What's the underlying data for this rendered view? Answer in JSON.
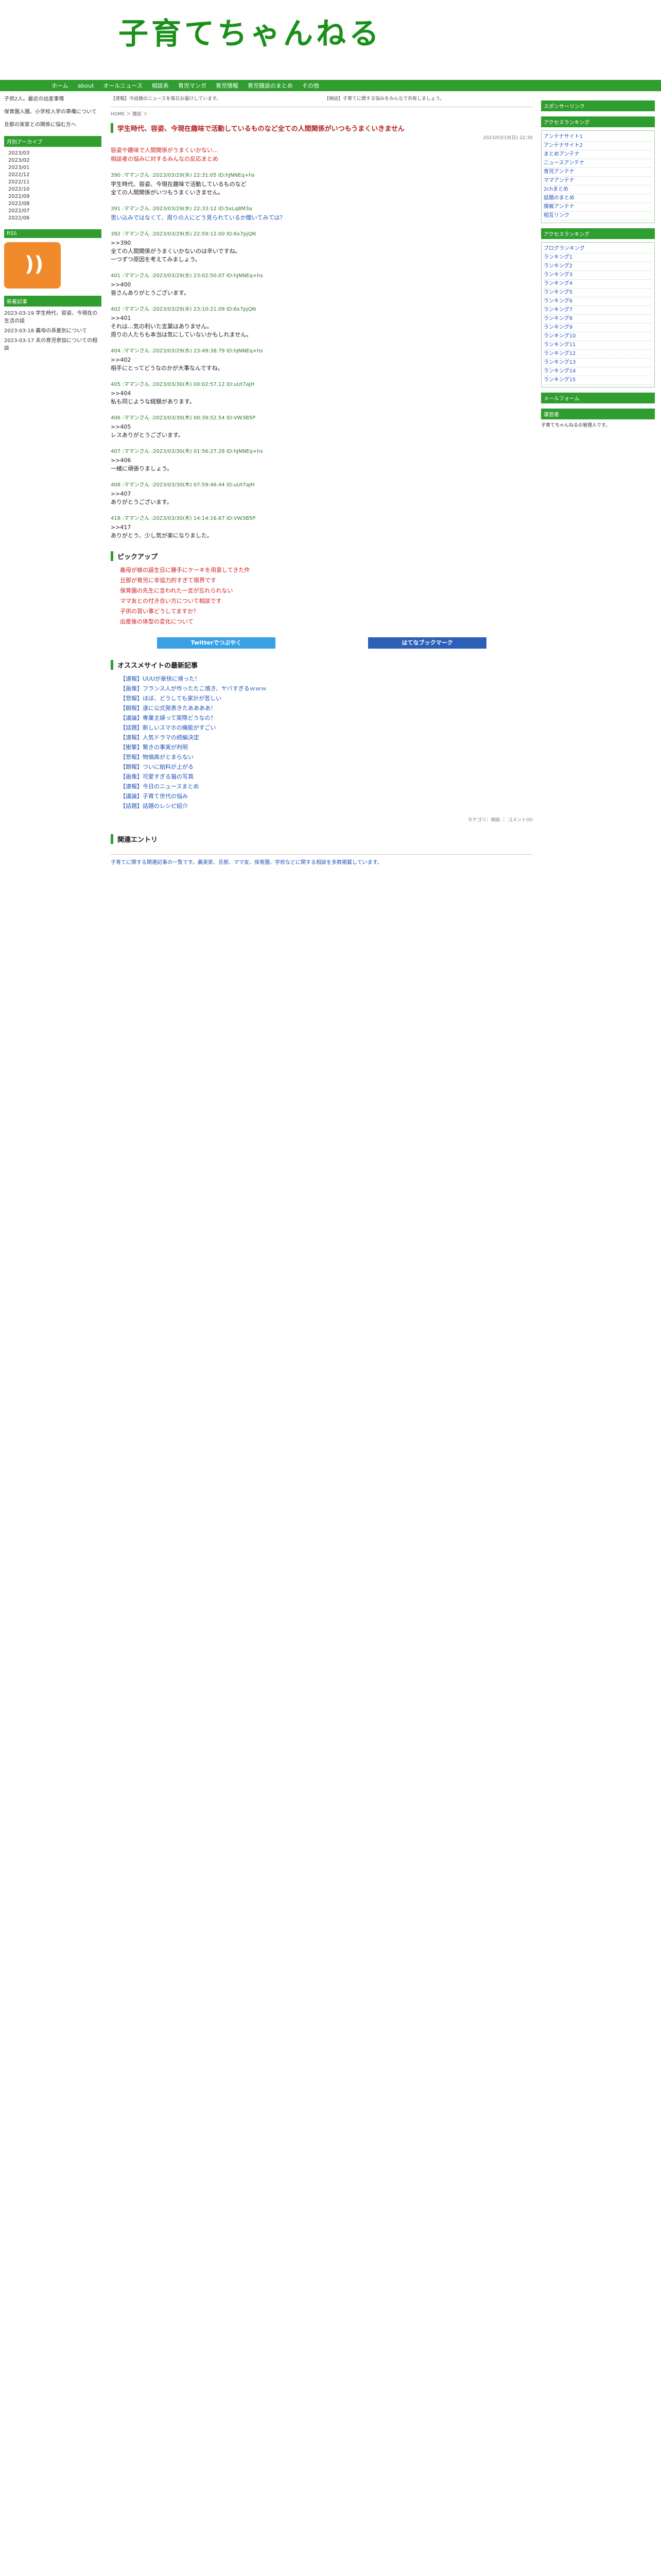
{
  "site": {
    "logo": "子育てちゃんねる"
  },
  "nav": [
    "ホーム",
    "about",
    "オールニュース",
    "相談系",
    "育児マンガ",
    "育児情報",
    "育児雑談のまとめ",
    "その他"
  ],
  "left": {
    "intro": [
      "子供2人。最近の出産事情",
      "保育園入園、小学校入学の準備について",
      "旦那の実家との関係に悩む方へ"
    ],
    "archive_head": "月別アーカイブ",
    "archive": [
      "2023/03",
      "2023/02",
      "2023/01",
      "2022/12",
      "2022/11",
      "2022/10",
      "2022/09",
      "2022/08",
      "2022/07",
      "2022/06"
    ],
    "rss_head": "RSS",
    "recent_head": "新着記事",
    "recent": [
      "2023-03-19 学生時代、容姿、今現在の生活の話",
      "2023-03-18 義母の孫差別について",
      "2023-03-17 夫の育児参加についての相談"
    ]
  },
  "main": {
    "topbox_left": "【速報】今話題のニュースを毎日お届けしています。",
    "topbox_right": "【相談】子育てに関する悩みをみんなで共有しましょう。",
    "breadcrumb": "HOME ＞ 雑談 ＞",
    "title": "学生時代、容姿、今現在趣味で活動しているものなど全ての人間関係がいつもうまくいきません",
    "date": "2023/03/19(日) 22:30",
    "redlinks": [
      "容姿や趣味で人間関係がうまくいかない…",
      "相談者の悩みに対するみんなの反応まとめ"
    ],
    "posts": [
      {
        "head": "390 :ママンさん :2023/03/29(水) 22:31:05 ID:hJNNEq+hs",
        "body": "学生時代、容姿、今現在趣味で活動しているものなど\n全ての人間関係がいつもうまくいきません。",
        "blue": false
      },
      {
        "head": "391 :ママンさん :2023/03/29(水) 22:33:12 ID:5xLq8M3a",
        "body": "思い込みではなくて、周りの人にどう見られているか聞いてみては？",
        "blue": true
      },
      {
        "head": "392 :ママンさん :2023/03/29(水) 22:59:12.00 ID:6x7pjQN",
        "body": ">>390\n全ての人間関係がうまくいかないのは辛いですね。\n一つずつ原因を考えてみましょう。",
        "blue": false
      },
      {
        "head": "401 :ママンさん :2023/03/29(水) 23:02:50.07 ID:hJNNEq+hs",
        "body": ">>400\n皆さんありがとうございます。",
        "blue": false
      },
      {
        "head": "402 :ママンさん :2023/03/29(水) 23:10:21.09 ID:6x7pjQN",
        "body": ">>401\nそれは…気の利いた言葉はありません。\n周りの人たちも本当は気にしていないかもしれません。",
        "blue": false
      },
      {
        "head": "404 :ママンさん :2023/03/29(水) 23:49:38.79 ID:hJNNEq+hs",
        "body": ">>402\n相手にとってどうなのかが大事なんですね。",
        "blue": false
      },
      {
        "head": "405 :ママンさん :2023/03/30(木) 00:02:57.12 ID:uUt7aJH",
        "body": ">>404\n私も同じような経験があります。",
        "blue": false
      },
      {
        "head": "406 :ママンさん :2023/03/30(木) 00:39:52.54 ID:VW3B5P",
        "body": ">>405\nレスありがとうございます。",
        "blue": false
      },
      {
        "head": "407 :ママンさん :2023/03/30(木) 01:56:27.28 ID:hJNNEq+hs",
        "body": ">>406\n一緒に頑張りましょう。",
        "blue": false
      },
      {
        "head": "408 :ママンさん :2023/03/30(木) 07:59:46.44 ID:uUt7aJH",
        "body": ">>407\nありがとうございます。",
        "blue": false
      },
      {
        "head": "418 :ママンさん :2023/03/30(木) 14:14:16.67 ID:VW3B5P",
        "body": ">>417\nありがとう、少し気が楽になりました。",
        "blue": false
      }
    ],
    "pickup_head": "ピックアップ",
    "pickups": [
      "義母が娘の誕生日に勝手にケーキを用意してきた件",
      "旦那が育児に非協力的すぎて限界です",
      "保育園の先生に言われた一言が忘れられない",
      "ママ友との付き合い方について相談です",
      "子供の習い事どうしてますか？",
      "出産後の体型の変化について"
    ],
    "btn_twitter": "Twitterでつぶやく",
    "btn_hatena": "はてなブックマーク",
    "new_head": "オススメサイトの最新記事",
    "new_items": [
      "【速報】UUUが豪快に帰った！",
      "【画像】フランス人が作ったたこ焼き、ヤバすぎるｗｗｗ",
      "【悲報】ほぼ、どうしても家計が苦しい",
      "【朗報】遂に公式発表きたああああ！",
      "【議論】専業主婦って実際どうなの？",
      "【話題】新しいスマホの機能がすごい",
      "【速報】人気ドラマの続編決定",
      "【衝撃】驚きの事実が判明",
      "【悲報】物価高がとまらない",
      "【朗報】ついに給料が上がる",
      "【画像】可愛すぎる猫の写真",
      "【速報】今日のニュースまとめ",
      "【議論】子育て世代の悩み",
      "【話題】話題のレシピ紹介"
    ],
    "category_line": "カテゴリ：相談 ｜ コメント(0)",
    "related_head": "関連エントリ",
    "related": "子育てに関する関連記事の一覧です。義実家、旦那、ママ友、保育園、学校などに関する相談を多数掲載しています。"
  },
  "right": {
    "sponsor_head": "スポンサーリンク",
    "antenna_head": "アクセスランキング",
    "antenna": [
      "アンテナサイト1",
      "アンテナサイト2",
      "まとめアンテナ",
      "ニュースアンテナ",
      "育児アンテナ",
      "ママアンテナ",
      "2chまとめ",
      "話題のまとめ",
      "情報アンテナ",
      "相互リンク"
    ],
    "ranking_head": "アクセスランキング",
    "ranking": [
      "ブログランキング",
      "ランキング1",
      "ランキング2",
      "ランキング3",
      "ランキング4",
      "ランキング5",
      "ランキング6",
      "ランキング7",
      "ランキング8",
      "ランキング9",
      "ランキング10",
      "ランキング11",
      "ランキング12",
      "ランキング13",
      "ランキング14",
      "ランキング15"
    ],
    "form_head": "メールフォーム",
    "about_head": "運営者",
    "about_text": "子育てちゃんねるの管理人です。"
  }
}
